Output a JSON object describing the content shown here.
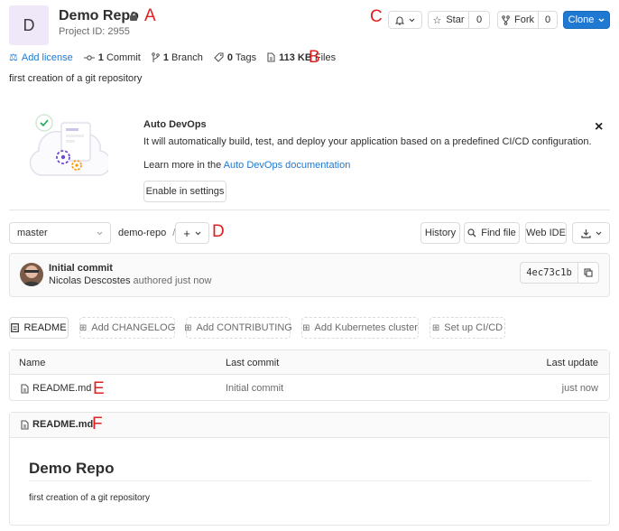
{
  "project": {
    "avatar_letter": "D",
    "name": "Demo Repo",
    "project_id": "Project ID: 2955",
    "description": "first creation of a git repository"
  },
  "markers": {
    "a": "A",
    "b": "B",
    "c": "C",
    "d": "D",
    "e": "E",
    "f": "F"
  },
  "header_actions": {
    "star_label": "Star",
    "star_count": "0",
    "fork_label": "Fork",
    "fork_count": "0",
    "clone_label": "Clone"
  },
  "stats": {
    "add_license": "Add license",
    "commits_count": "1",
    "commits_label": "Commit",
    "branches_count": "1",
    "branches_label": "Branch",
    "tags_count": "0",
    "tags_label": "Tags",
    "files_size": "113 KB",
    "files_label": "Files"
  },
  "autodevops": {
    "title": "Auto DevOps",
    "body": "It will automatically build, test, and deploy your application based on a predefined CI/CD configuration.",
    "learn_prefix": "Learn more in the ",
    "learn_link": "Auto DevOps documentation",
    "button": "Enable in settings",
    "close": "×"
  },
  "nav": {
    "branch": "master",
    "path": "demo-repo",
    "separator": "/",
    "add": "+",
    "history": "History",
    "find_file": "Find file",
    "web_ide": "Web IDE"
  },
  "commit": {
    "title": "Initial commit",
    "author": "Nicolas Descostes",
    "authored": "authored just now",
    "sha": "4ec73c1b"
  },
  "shortcuts": [
    "README",
    "Add CHANGELOG",
    "Add CONTRIBUTING",
    "Add Kubernetes cluster",
    "Set up CI/CD"
  ],
  "table": {
    "headers": {
      "name": "Name",
      "last_commit": "Last commit",
      "last_update": "Last update"
    },
    "rows": [
      {
        "name": "README.md",
        "commit": "Initial commit",
        "updated": "just now"
      }
    ]
  },
  "readme": {
    "filename": "README.md",
    "heading": "Demo Repo",
    "body": "first creation of a git repository"
  },
  "colors": {
    "accent": "#1f78d1",
    "marker": "#e02020"
  }
}
